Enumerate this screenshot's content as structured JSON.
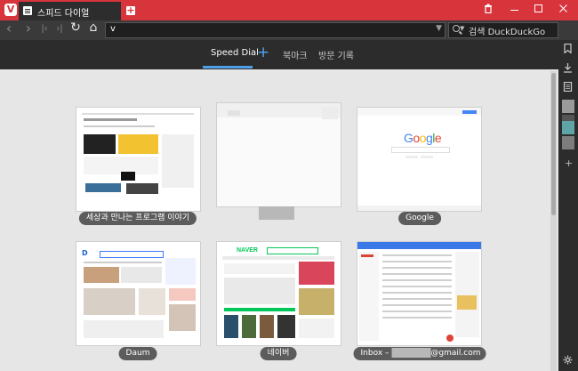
{
  "window": {
    "tab_title": "스피드 다이얼",
    "url_value": "v",
    "search_placeholder": "검색 DuckDuckGo",
    "close_glyph": "✕",
    "minimize_glyph": "—",
    "maximize_glyph": "☐",
    "trash_glyph": "🗑"
  },
  "navigation": {
    "back": "‹",
    "forward": "›",
    "first": "|‹",
    "last": "›|",
    "reload": "↻",
    "home": "⌂"
  },
  "speed_dial_tabs": {
    "speed_dial": "Speed Dial",
    "add": "+",
    "bookmarks": "북마크",
    "history": "방문 기록"
  },
  "dials": [
    {
      "caption": "세상과 만나는 프로그램 이야기"
    },
    {
      "caption": ""
    },
    {
      "caption": "Google"
    },
    {
      "caption": "Daum"
    },
    {
      "caption": "네이버"
    },
    {
      "caption_prefix": "Inbox – ",
      "caption_suffix": "@gmail.com"
    }
  ],
  "thumbnail_text": {
    "google_logo": "Google",
    "naver_logo": "NAVER"
  },
  "colors": {
    "title_bar": "#d8343c",
    "accent": "#4e9ee8",
    "dark_bg": "#2c2c2c"
  },
  "icons": [
    "vivaldi-logo-icon",
    "tab-page-icon",
    "new-tab-icon",
    "trash-icon",
    "minimize-icon",
    "maximize-icon",
    "close-icon",
    "search-icon",
    "bookmark-icon",
    "download-icon",
    "notes-icon",
    "settings-icon"
  ]
}
